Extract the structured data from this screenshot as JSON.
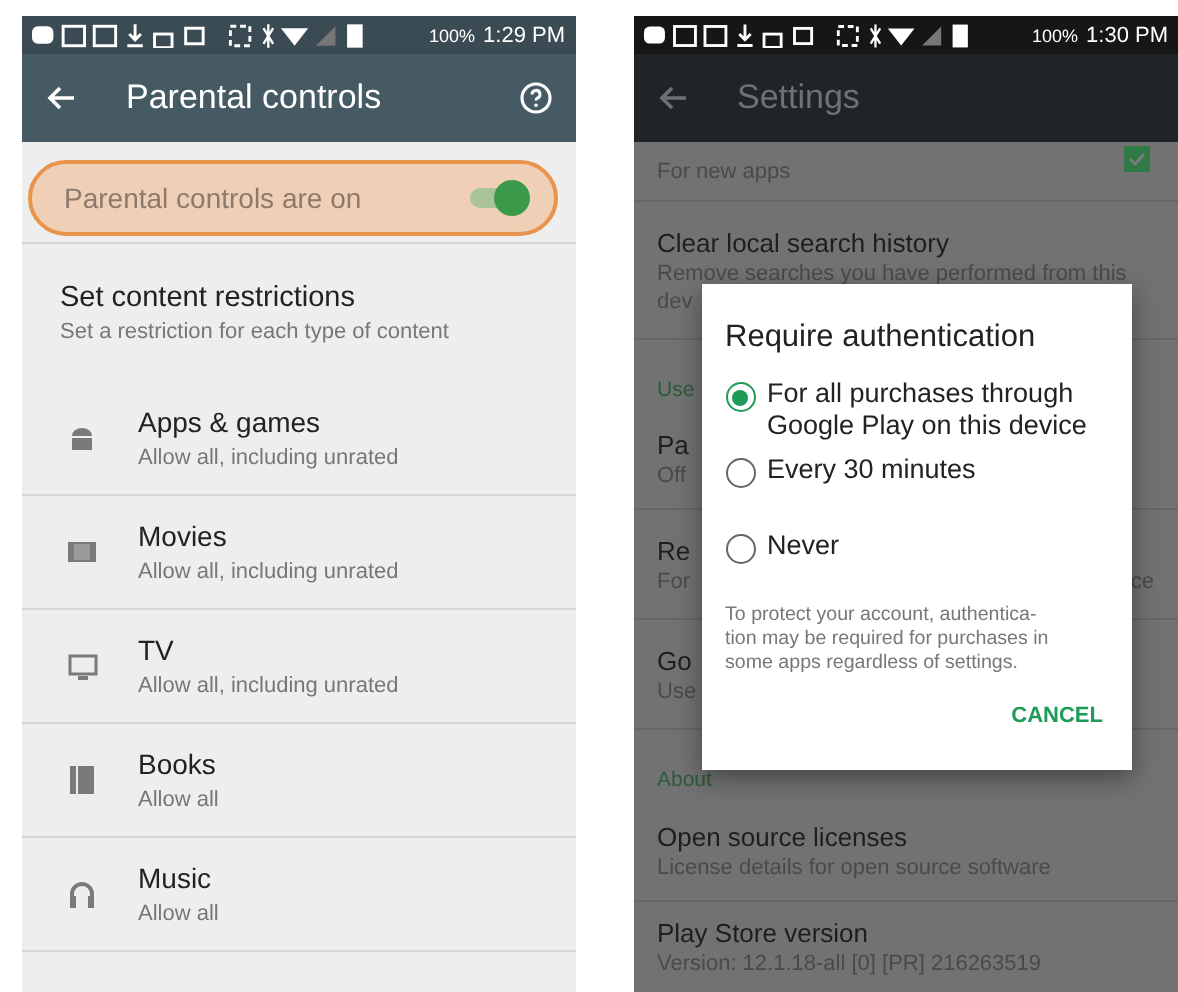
{
  "parental_controls_screen": {
    "status_bar": {
      "battery": "100%",
      "time": "1:29 PM"
    },
    "app_bar": {
      "title": "Parental controls"
    },
    "master_toggle": {
      "label": "Parental controls are on",
      "on": true,
      "highlighted": true
    },
    "restrictions_header": {
      "title": "Set content restrictions",
      "subtitle": "Set a restriction for each type of content"
    },
    "categories": [
      {
        "kind": "apps",
        "title": "Apps & games",
        "subtitle": "Allow all, including unrated"
      },
      {
        "kind": "movies",
        "title": "Movies",
        "subtitle": "Allow all, including unrated"
      },
      {
        "kind": "tv",
        "title": "TV",
        "subtitle": "Allow all, including unrated"
      },
      {
        "kind": "books",
        "title": "Books",
        "subtitle": "Allow all"
      },
      {
        "kind": "music",
        "title": "Music",
        "subtitle": "Allow all"
      }
    ]
  },
  "settings_screen": {
    "status_bar": {
      "battery": "100%",
      "time": "1:30 PM"
    },
    "app_bar": {
      "title": "Settings"
    },
    "items": [
      {
        "kind": "row",
        "subtitle_lines": [
          "For new apps"
        ],
        "checked": true
      },
      {
        "kind": "row",
        "title": "Clear local search history",
        "subtitle_lines": [
          "Remove searches you have performed from this",
          "dev"
        ]
      },
      {
        "kind": "header",
        "title": "Use"
      },
      {
        "kind": "row",
        "title": "Pa",
        "subtitle_lines": [
          "Off"
        ]
      },
      {
        "kind": "row",
        "title": "Re",
        "subtitle_lines": [
          "For"
        ],
        "subtitle_right": "ce"
      },
      {
        "kind": "row",
        "title": "Go",
        "subtitle_lines": [
          "Use"
        ]
      },
      {
        "kind": "header",
        "title": "About"
      },
      {
        "kind": "row",
        "title": "Open source licenses",
        "subtitle_lines": [
          "License details for open source software"
        ]
      },
      {
        "kind": "row",
        "title": "Play Store version",
        "subtitle_lines": [
          "Version: 12.1.18-all [0] [PR] 216263519"
        ]
      }
    ],
    "dialog": {
      "title": "Require authentication",
      "options": [
        {
          "label": "For all purchases through Google Play on this device",
          "selected": true
        },
        {
          "label": "Every 30 minutes",
          "selected": false
        },
        {
          "label": "Never",
          "selected": false
        }
      ],
      "note_lines": [
        "To protect your account, authentica-",
        "tion may be required for purchases in",
        "some apps regardless of settings."
      ],
      "button": "CANCEL"
    }
  }
}
